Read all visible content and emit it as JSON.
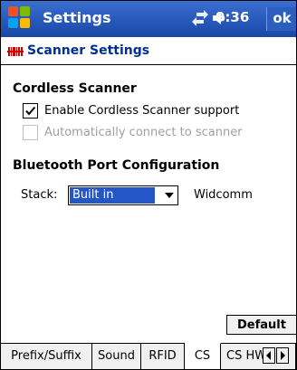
{
  "titlebar": {
    "title": "Settings",
    "time": "9:36",
    "ok_label": "ok",
    "icons": [
      "windows-start-icon",
      "connectivity-icon",
      "volume-icon"
    ]
  },
  "app": {
    "title": "Scanner Settings",
    "icon": "scanner-settings-icon"
  },
  "cordless": {
    "section_title": "Cordless Scanner",
    "enable_label": "Enable Cordless Scanner support",
    "enable_checked": true,
    "auto_connect_label": "Automatically connect to scanner",
    "auto_connect_checked": false
  },
  "bluetooth": {
    "section_title": "Bluetooth Port Configuration",
    "stack_label": "Stack:",
    "stack_value": "Built in",
    "alt_stack": "Widcomm"
  },
  "buttons": {
    "default_label": "Default"
  },
  "tabs": [
    {
      "label": "Prefix/Suffix",
      "active": false
    },
    {
      "label": "Sound",
      "active": false
    },
    {
      "label": "RFID",
      "active": false
    },
    {
      "label": "CS",
      "active": true
    },
    {
      "label": "CS HW",
      "active": false
    }
  ],
  "colors": {
    "titlebar": "#1947a8",
    "app_title": "#00308f",
    "selection": "#2456c8"
  }
}
